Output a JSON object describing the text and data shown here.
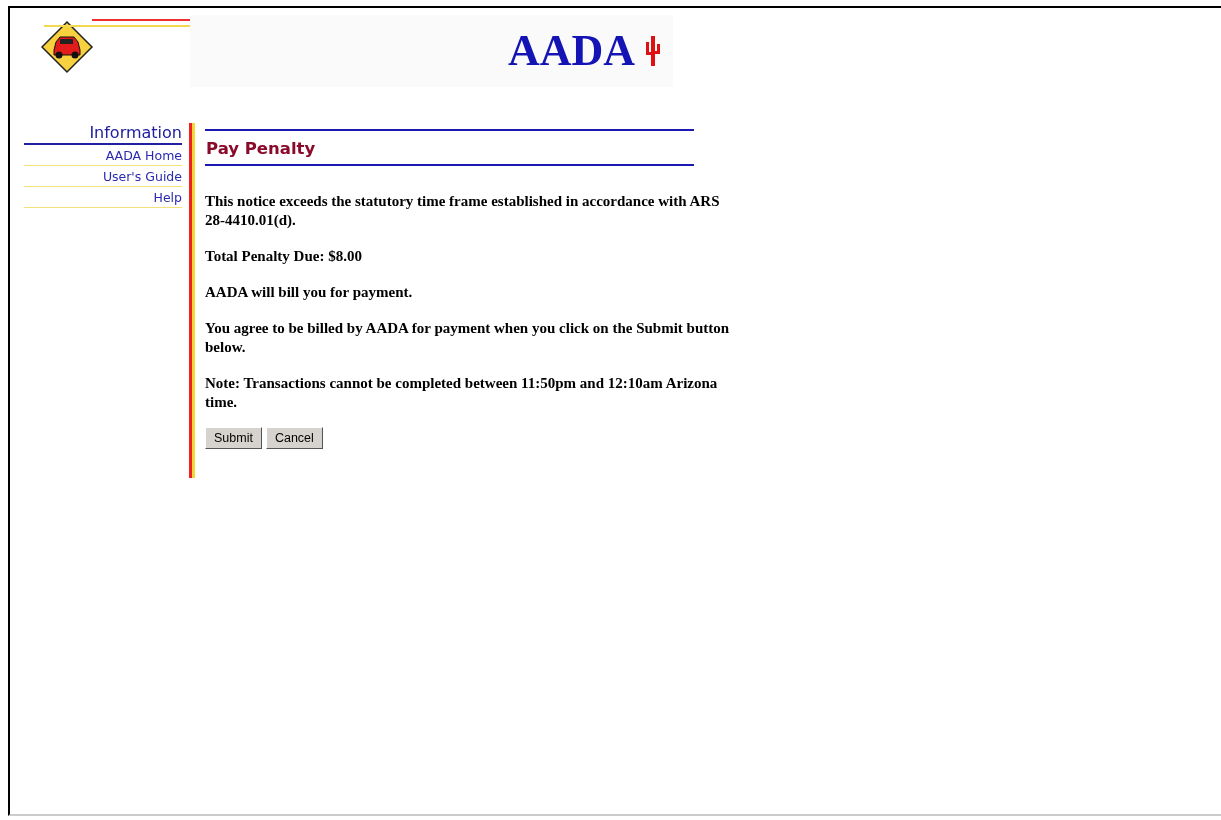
{
  "header": {
    "logo_text": "AADA"
  },
  "sidebar": {
    "heading": "Information",
    "links": [
      "AADA Home",
      "User's Guide",
      "Help"
    ]
  },
  "main": {
    "title": "Pay Penalty",
    "paragraphs": [
      "This notice exceeds the statutory time frame established in accordance with ARS 28-4410.01(d).",
      "Total Penalty Due: $8.00",
      "AADA will bill you for payment.",
      "You agree to be billed by AADA for payment when you click on the Submit button below.",
      "Note: Transactions cannot be completed between 11:50pm and 12:10am Arizona time."
    ],
    "buttons": [
      "Submit",
      "Cancel"
    ]
  }
}
